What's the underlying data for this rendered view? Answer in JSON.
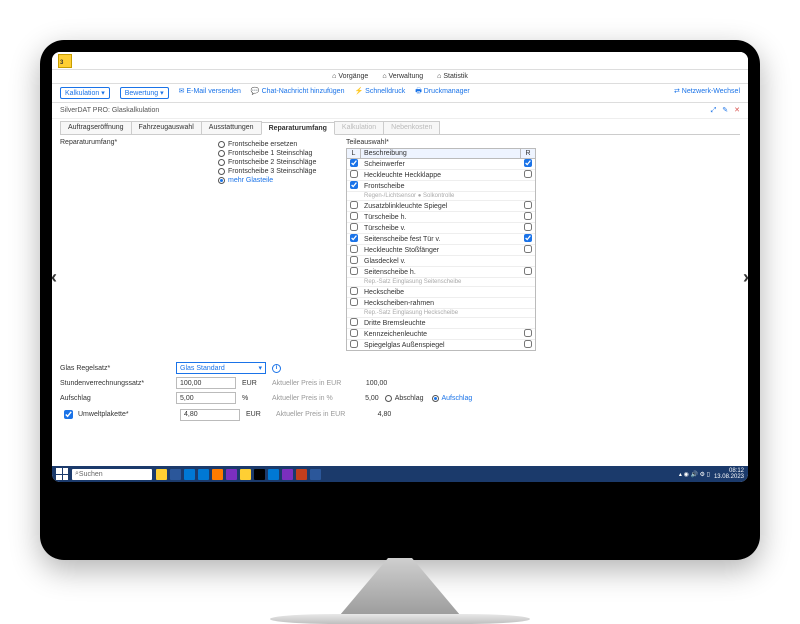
{
  "logo_text": "3",
  "topnav": {
    "vorgaenge": "Vorgänge",
    "verwaltung": "Verwaltung",
    "statistik": "Statistik"
  },
  "actionbar": {
    "kalkulation": "Kalkulation ▾",
    "bewertung": "Bewertung ▾",
    "email": "E-Mail versenden",
    "chat": "Chat-Nachricht hinzufügen",
    "schnelldruck": "Schnelldruck",
    "druckmanager": "Druckmanager",
    "netzwerk": "Netzwerk-Wechsel"
  },
  "breadcrumb": "SilverDAT PRO: Glaskalkulation",
  "tabs": {
    "auftrag": "Auftragseröffnung",
    "fahrzeug": "Fahrzeugauswahl",
    "ausstattung": "Ausstattungen",
    "reparatur": "Reparaturumfang",
    "kalkulation": "Kalkulation",
    "nebenkosten": "Nebenkosten"
  },
  "rep": {
    "label": "Reparaturumfang*",
    "radios": [
      {
        "label": "Frontscheibe ersetzen",
        "sel": false
      },
      {
        "label": "Frontscheibe 1 Steinschlag",
        "sel": false
      },
      {
        "label": "Frontscheibe 2 Steinschläge",
        "sel": false
      },
      {
        "label": "Frontscheibe 3 Steinschläge",
        "sel": false
      },
      {
        "label": "mehr Glasteile",
        "sel": true
      }
    ]
  },
  "teile": {
    "label": "Teileauswahl*",
    "hdr_l": "L",
    "hdr_desc": "Beschreibung",
    "hdr_r": "R",
    "rows": [
      {
        "l": true,
        "txt": "Scheinwerfer",
        "r": true
      },
      {
        "l": false,
        "txt": "Heckleuchte Heckklappe",
        "r": false
      },
      {
        "l": true,
        "txt": "Frontscheibe",
        "single": true
      },
      {
        "sub": true,
        "txt": "Regen-/Lichtsensor ● Solkontrolle"
      },
      {
        "l": false,
        "txt": "Zusatzblinkleuchte Spiegel",
        "r": false
      },
      {
        "l": false,
        "txt": "Türscheibe h.",
        "r": false
      },
      {
        "l": false,
        "txt": "Türscheibe v.",
        "r": false
      },
      {
        "l": true,
        "txt": "Seitenscheibe fest Tür v.",
        "r": true
      },
      {
        "l": false,
        "txt": "Heckleuchte Stoßfänger",
        "r": false
      },
      {
        "l": false,
        "txt": "Glasdeckel v.",
        "single": true
      },
      {
        "l": false,
        "txt": "Seitenscheibe h.",
        "r": false
      },
      {
        "sub": true,
        "txt": "Rep.-Satz Einglasung Seitenscheibe"
      },
      {
        "l": false,
        "txt": "Heckscheibe",
        "single": true
      },
      {
        "l": false,
        "txt": "Heckscheiben-rahmen",
        "single": true
      },
      {
        "sub": true,
        "txt": "Rep.-Satz Einglasung Heckscheibe"
      },
      {
        "l": false,
        "txt": "Dritte Bremsleuchte",
        "single": true
      },
      {
        "l": false,
        "txt": "Kennzeichenleuchte",
        "r": false
      },
      {
        "l": false,
        "txt": "Spiegelglas Außenspiegel",
        "r": false
      }
    ]
  },
  "form": {
    "regelsatz_label": "Glas Regelsatz*",
    "regelsatz_value": "Glas Standard",
    "stunden_label": "Stundenverrechnungssatz*",
    "stunden_value": "100,00",
    "stunden_unit": "EUR",
    "stunden_hint": "Aktueller Preis in EUR",
    "stunden_cur": "100,00",
    "aufschlag_label": "Aufschlag",
    "aufschlag_value": "5,00",
    "aufschlag_unit": "%",
    "aufschlag_hint": "Aktueller Preis in %",
    "aufschlag_cur": "5,00",
    "abschlag_opt": "Abschlag",
    "aufschlag_opt": "Aufschlag",
    "umwelt_label": "Umweltplakette*",
    "umwelt_checked": true,
    "umwelt_value": "4,80",
    "umwelt_unit": "EUR",
    "umwelt_hint": "Aktueller Preis in EUR",
    "umwelt_cur": "4,80"
  },
  "taskbar": {
    "search": "Suchen",
    "time": "08:12",
    "date": "13.08.2023",
    "icon_colors": [
      "#ffcf33",
      "#2b579a",
      "#0078d4",
      "#0078d4",
      "#ff7b00",
      "#7b2fbf",
      "#ffcf33",
      "#000",
      "#0078d4",
      "#7b2fbf",
      "#c43e1c",
      "#2b579a"
    ]
  }
}
